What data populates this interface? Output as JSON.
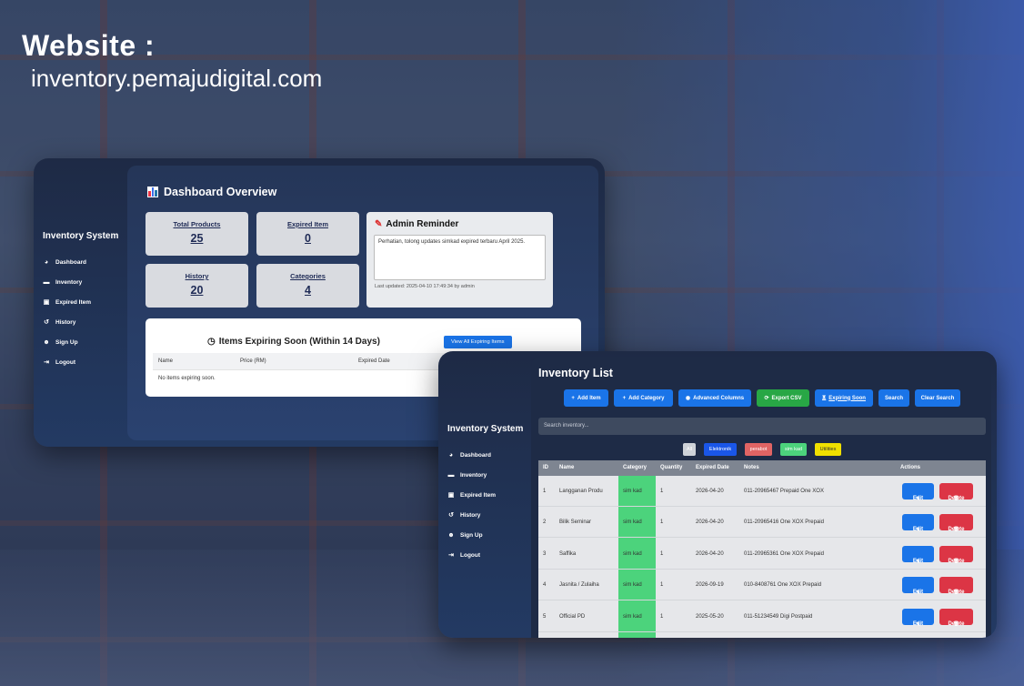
{
  "promo": {
    "heading": "Website :",
    "url": "inventory.pemajudigital.com"
  },
  "dashboard": {
    "brand": "Inventory System",
    "nav": [
      {
        "label": "Dashboard",
        "icon": "dashboard-icon"
      },
      {
        "label": "Inventory",
        "icon": "box-icon"
      },
      {
        "label": "Expired Item",
        "icon": "calendar-icon"
      },
      {
        "label": "History",
        "icon": "history-icon"
      },
      {
        "label": "Sign Up",
        "icon": "user-plus-icon"
      },
      {
        "label": "Logout",
        "icon": "logout-icon"
      }
    ],
    "title": "Dashboard Overview",
    "stats": [
      {
        "label": "Total Products",
        "value": "25"
      },
      {
        "label": "Expired Item",
        "value": "0"
      },
      {
        "label": "History",
        "value": "20"
      },
      {
        "label": "Categories",
        "value": "4"
      }
    ],
    "reminder": {
      "title": "Admin Reminder",
      "text": "Perhatian, tolong updates simkad expired terbaru April 2025.",
      "updated": "Last updated: 2025-04-10 17:49:34 by admin"
    },
    "expiring": {
      "title": "Items Expiring Soon (Within 14 Days)",
      "button": "View All Expiring Items",
      "columns": [
        "Name",
        "Price (RM)",
        "Expired Date"
      ],
      "empty": "No items expiring soon."
    }
  },
  "inventory": {
    "brand": "Inventory System",
    "nav": [
      {
        "label": "Dashboard",
        "icon": "dashboard-icon"
      },
      {
        "label": "Inventory",
        "icon": "box-icon"
      },
      {
        "label": "Expired Item",
        "icon": "calendar-icon"
      },
      {
        "label": "History",
        "icon": "history-icon"
      },
      {
        "label": "Sign Up",
        "icon": "user-plus-icon"
      },
      {
        "label": "Logout",
        "icon": "logout-icon"
      }
    ],
    "title": "Inventory List",
    "toolbar": {
      "add_item": "Add Item",
      "add_category": "Add Category",
      "advanced": "Advanced Columns",
      "export": "Export CSV",
      "expiring": "Expiring Soon",
      "search": "Search",
      "clear": "Clear Search"
    },
    "search_placeholder": "Search inventory...",
    "filters": [
      {
        "label": "All",
        "color": "#ced2d8"
      },
      {
        "label": "Elektronik",
        "color": "#1a56e8"
      },
      {
        "label": "perabot",
        "color": "#e06464"
      },
      {
        "label": "sim kad",
        "color": "#4cd37c"
      },
      {
        "label": "Utilities",
        "color": "#f0e000"
      }
    ],
    "columns": [
      "ID",
      "Name",
      "Category",
      "Quantity",
      "Expired Date",
      "Notes",
      "Actions"
    ],
    "rows": [
      {
        "id": "1",
        "name": "Langganan Produ",
        "category": "sim kad",
        "qty": "1",
        "date": "2026-04-20",
        "notes": "011-20965467 Prepaid One XOX"
      },
      {
        "id": "2",
        "name": "Bilik Seminar",
        "category": "sim kad",
        "qty": "1",
        "date": "2026-04-20",
        "notes": "011-20965416 One XOX Prepaid"
      },
      {
        "id": "3",
        "name": "Saffika",
        "category": "sim kad",
        "qty": "1",
        "date": "2026-04-20",
        "notes": "011-20965361 One XOX Prepaid"
      },
      {
        "id": "4",
        "name": "Jasnita / Zulaiha",
        "category": "sim kad",
        "qty": "1",
        "date": "2026-09-19",
        "notes": "010-8408761 One XOX Prepaid"
      },
      {
        "id": "5",
        "name": "Official PD",
        "category": "sim kad",
        "qty": "1",
        "date": "2025-05-20",
        "notes": "011-51234549 Digi Postpaid"
      }
    ],
    "edit_label": "Edit",
    "delete_label": "Delete"
  }
}
